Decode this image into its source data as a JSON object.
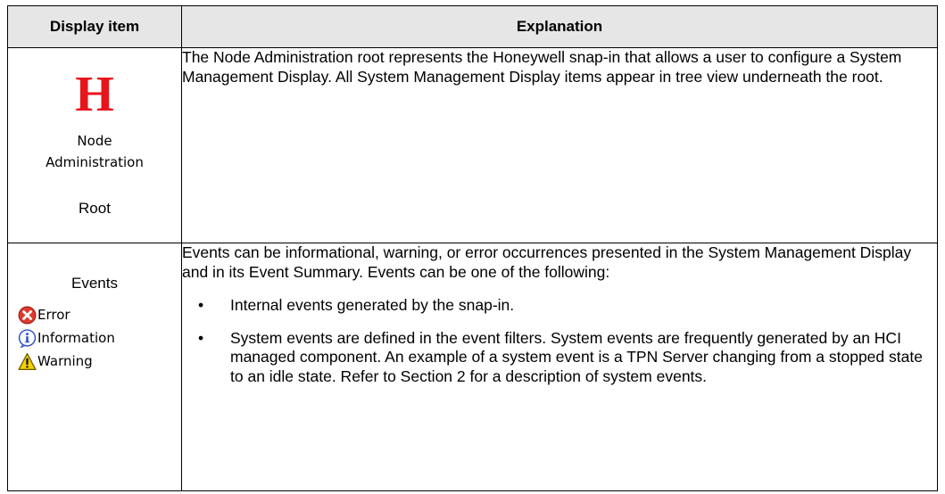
{
  "table": {
    "headers": [
      "Display item",
      "Explanation"
    ],
    "rows": [
      {
        "item": {
          "logo_letter": "H",
          "tree_label_lines": [
            "Node",
            "Administration"
          ],
          "caption": "Root"
        },
        "explanation": {
          "paragraph": "The Node Administration root represents the Honeywell snap-in that allows a user to configure a System Management Display. All System Management Display items appear in tree view underneath the root.",
          "bullets": []
        }
      },
      {
        "item": {
          "caption": "Events",
          "event_types": [
            {
              "icon": "error-icon",
              "label": "Error",
              "color": "#e03a2f"
            },
            {
              "icon": "information-icon",
              "label": "Information",
              "color": "#2b4fcf"
            },
            {
              "icon": "warning-icon",
              "label": "Warning",
              "color": "#f2d100"
            }
          ]
        },
        "explanation": {
          "paragraph": "Events can be informational, warning, or error occurrences presented in the System Management Display and in its Event Summary. Events can be one of the following:",
          "bullets": [
            "Internal events generated by the snap-in.",
            "System events are defined in the event filters. System events are frequently generated by an HCI managed component. An example of a system event is a TPN Server changing from a stopped state to an idle state. Refer to Section 2 for a description of system events."
          ]
        }
      }
    ]
  },
  "colors": {
    "header_background": "#e6e6e6",
    "honeywell_red": "#e8141c",
    "border": "#000000"
  }
}
